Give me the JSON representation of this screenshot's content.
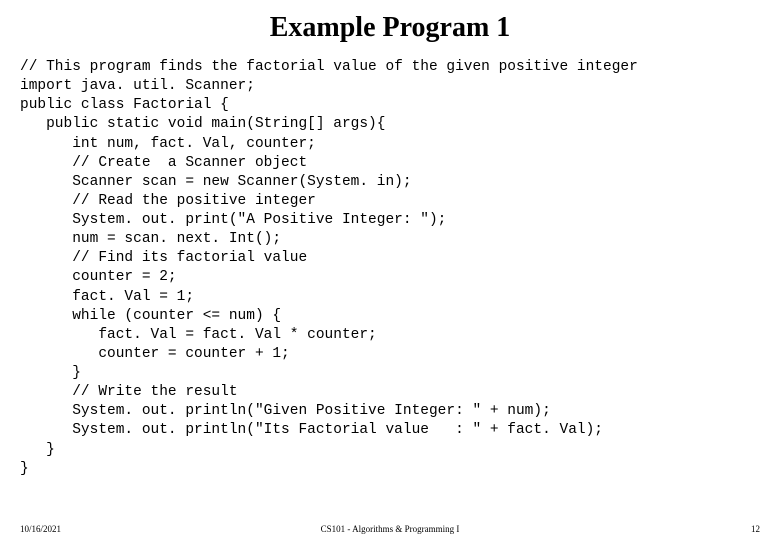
{
  "title": "Example Program 1",
  "code": "// This program finds the factorial value of the given positive integer\nimport java. util. Scanner;\npublic class Factorial {\n   public static void main(String[] args){\n      int num, fact. Val, counter;\n      // Create  a Scanner object\n      Scanner scan = new Scanner(System. in);\n      // Read the positive integer\n      System. out. print(\"A Positive Integer: \");\n      num = scan. next. Int();\n      // Find its factorial value\n      counter = 2;\n      fact. Val = 1;\n      while (counter <= num) {\n         fact. Val = fact. Val * counter;\n         counter = counter + 1;\n      }\n      // Write the result\n      System. out. println(\"Given Positive Integer: \" + num);\n      System. out. println(\"Its Factorial value   : \" + fact. Val);\n   }\n}",
  "footer": {
    "date": "10/16/2021",
    "course": "CS101 - Algorithms & Programming I",
    "page": "12"
  }
}
